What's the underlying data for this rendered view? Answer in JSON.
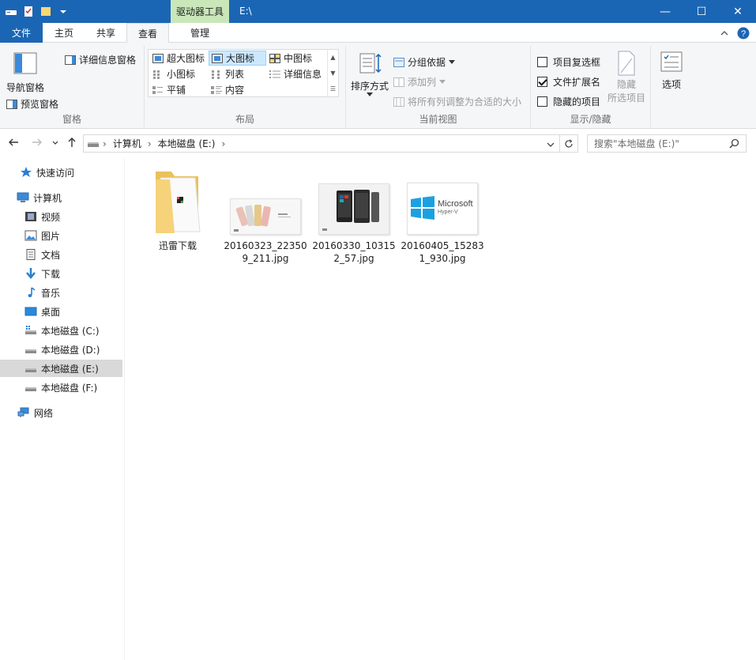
{
  "titlebar": {
    "context_tab": "驱动器工具",
    "title": "E:\\",
    "minimize": "—",
    "maximize": "☐",
    "close": "✕"
  },
  "tabs": {
    "file": "文件",
    "home": "主页",
    "share": "共享",
    "view": "查看",
    "manage": "管理"
  },
  "ribbon": {
    "panes": {
      "nav_pane": "导航窗格",
      "preview_pane": "预览窗格",
      "details_pane": "详细信息窗格",
      "label": "窗格"
    },
    "layout": {
      "extra_large": "超大图标",
      "large": "大图标",
      "medium": "中图标",
      "small": "小图标",
      "list": "列表",
      "details": "详细信息",
      "tiles": "平铺",
      "content": "内容",
      "label": "布局"
    },
    "current_view": {
      "sort_by": "排序方式",
      "group_by": "分组依据",
      "add_column": "添加列",
      "fit_columns": "将所有列调整为合适的大小",
      "label": "当前视图"
    },
    "show_hide": {
      "item_checkboxes": "项目复选框",
      "item_checkboxes_checked": false,
      "file_extensions": "文件扩展名",
      "file_extensions_checked": true,
      "hidden_items": "隐藏的项目",
      "hidden_items_checked": false,
      "hide_selected_1": "隐藏",
      "hide_selected_2": "所选项目",
      "label": "显示/隐藏"
    },
    "options": "选项"
  },
  "address": {
    "crumbs": [
      "计算机",
      "本地磁盘 (E:)"
    ],
    "search_placeholder": "搜索\"本地磁盘 (E:)\""
  },
  "navpane": {
    "quick_access": "快速访问",
    "computer": "计算机",
    "videos": "视频",
    "pictures": "图片",
    "documents": "文档",
    "downloads": "下载",
    "music": "音乐",
    "desktop": "桌面",
    "drive_c": "本地磁盘 (C:)",
    "drive_d": "本地磁盘 (D:)",
    "drive_e": "本地磁盘 (E:)",
    "drive_f": "本地磁盘 (F:)",
    "network": "网络"
  },
  "files": [
    {
      "name": "迅雷下载",
      "type": "folder"
    },
    {
      "name": "20160323_223509_211.jpg",
      "type": "image"
    },
    {
      "name": "20160330_103152_57.jpg",
      "type": "image"
    },
    {
      "name": "20160405_152831_930.jpg",
      "type": "image"
    }
  ],
  "thumb_text": {
    "microsoft": "Microsoft",
    "hyperv": "Hyper-V"
  },
  "colors": {
    "titlebar": "#1b66b4",
    "context_tab": "#c9e7b9",
    "selected_layout": "#cce8ff"
  }
}
